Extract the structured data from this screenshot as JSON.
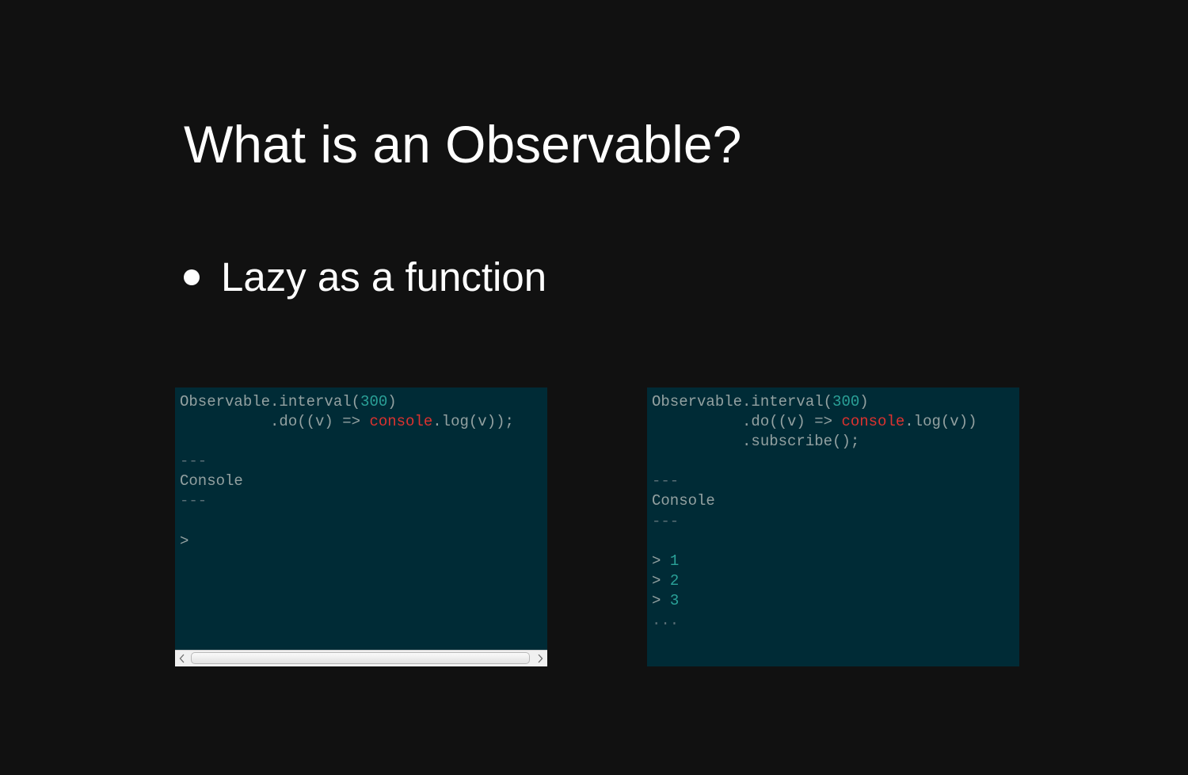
{
  "slide": {
    "title": "What is an Observable?",
    "bullets": [
      "Lazy as a function"
    ]
  },
  "colors": {
    "background": "#111111",
    "code_background": "#002b36",
    "code_text": "#93a1a1",
    "number": "#2aa198",
    "identifier_highlight": "#dc322f",
    "separator": "#586e75"
  },
  "left_panel": {
    "code": {
      "l1_a": "Observable.interval(",
      "l1_num": "300",
      "l1_b": ")",
      "l2_a": "          .do((v) => ",
      "l2_red": "console",
      "l2_b": ".log(v));"
    },
    "separator": "---",
    "console_label": "Console",
    "prompt": ">",
    "scrollbar": {
      "left_arrow_icon": "chevron-left-icon",
      "right_arrow_icon": "chevron-right-icon"
    }
  },
  "right_panel": {
    "code": {
      "l1_a": "Observable.interval(",
      "l1_num": "300",
      "l1_b": ")",
      "l2_a": "          .do((v) => ",
      "l2_red": "console",
      "l2_b": ".log(v))",
      "l3": "          .subscribe();"
    },
    "separator": "---",
    "console_label": "Console",
    "output": [
      {
        "prompt": ">",
        "value": "1"
      },
      {
        "prompt": ">",
        "value": "2"
      },
      {
        "prompt": ">",
        "value": "3"
      }
    ],
    "ellipsis": "..."
  }
}
